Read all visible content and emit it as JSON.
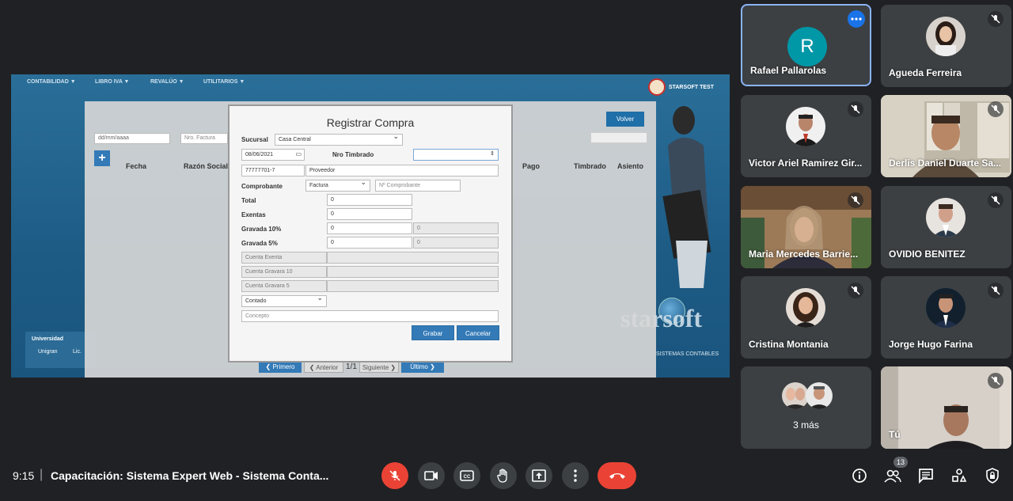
{
  "shared_screen": {
    "nav": [
      "CONTABILIDAD ▼",
      "LIBRO IVA ▼",
      "REVALÚO ▼",
      "UTILITARIOS ▼"
    ],
    "brand": "STARSOFT TEST",
    "filters": {
      "date_placeholder": "dd/mm/aaaa",
      "nro_factura_placeholder": "Nro. Factura"
    },
    "volver_label": "Volver",
    "table_headers": [
      "Fecha",
      "Razón Social",
      "Pago",
      "Timbrado",
      "Asiento"
    ],
    "pager": {
      "first": "❮ Primero",
      "prev": "❮ Anterior",
      "page": "1/1",
      "next": "Siguiente ❯",
      "last": "Último ❯"
    },
    "bottom_left": {
      "title": "Universidad",
      "item1": "Unigran",
      "item2": "Lic."
    },
    "starsoft_logo": "starsoft",
    "starsoft_sub": "SISTEMAS CONTABLES",
    "modal": {
      "title": "Registrar Compra",
      "sucursal_label": "Sucursal",
      "sucursal_value": "Casa Central",
      "fecha_value": "08/06/2021",
      "nro_timbrado_label": "Nro Timbrado",
      "ruc_value": "77777701-7",
      "proveedor_placeholder": "Proveedor",
      "comprobante_label": "Comprobante",
      "comprobante_type": "Factura",
      "nro_comprobante_placeholder": "Nº Comprobante",
      "total_label": "Total",
      "total_value": "0",
      "exentas_label": "Exentas",
      "exentas_value": "0",
      "gravada10_label": "Gravada 10%",
      "gravada10_value": "0",
      "gravada10_iva": "0",
      "gravada5_label": "Gravada 5%",
      "gravada5_value": "0",
      "gravada5_iva": "0",
      "cuenta_exenta": "Cuenta Exenta",
      "cuenta_gravada10": "Cuenta Gravara 10",
      "cuenta_gravada5": "Cuenta Gravara 5",
      "pago_value": "Contado",
      "concepto_placeholder": "Concepto",
      "grabar_label": "Grabar",
      "cancelar_label": "Cancelar"
    }
  },
  "participants": [
    {
      "name": "Rafael Pallarolas",
      "initial": "R",
      "avatar_color": "#0097a7"
    },
    {
      "name": "Agueda Ferreira"
    },
    {
      "name": "Victor Ariel Ramirez Gir..."
    },
    {
      "name": "Derlis Daniel Duarte Sa..."
    },
    {
      "name": "Maria Mercedes Barrie..."
    },
    {
      "name": "OVIDIO BENITEZ"
    },
    {
      "name": "Cristina Montania"
    },
    {
      "name": "Jorge Hugo Farina"
    },
    {
      "name": "3 más"
    },
    {
      "name": "Tú"
    }
  ],
  "bottom_bar": {
    "time": "9:15",
    "separator": "|",
    "meeting_title": "Capacitación: Sistema Expert Web - Sistema Conta...",
    "people_count": "13"
  }
}
